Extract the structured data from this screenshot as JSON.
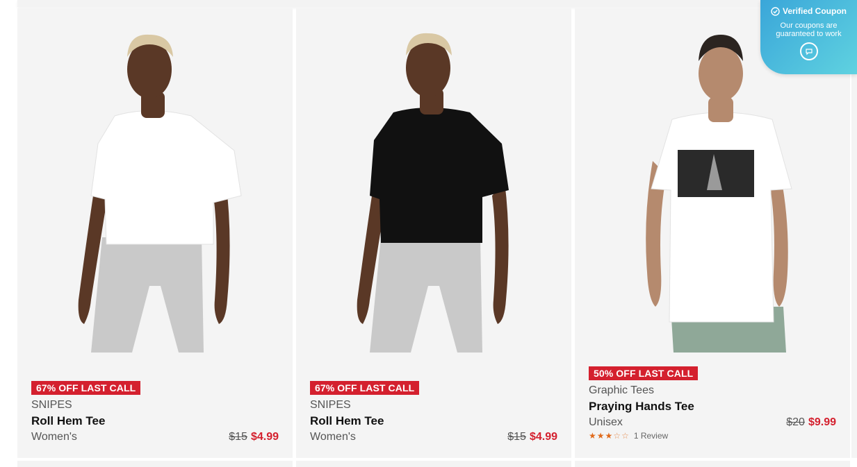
{
  "products": [
    {
      "badge": "67% OFF LAST CALL",
      "brand": "SNIPES",
      "name": "Roll Hem Tee",
      "gender": "Women's",
      "price_old": "$15",
      "price_new": "$4.99",
      "shirt_color": "#ffffff"
    },
    {
      "badge": "67% OFF LAST CALL",
      "brand": "SNIPES",
      "name": "Roll Hem Tee",
      "gender": "Women's",
      "price_old": "$15",
      "price_new": "$4.99",
      "shirt_color": "#111111"
    },
    {
      "badge": "50% OFF LAST CALL",
      "brand": "Graphic Tees",
      "name": "Praying Hands Tee",
      "gender": "Unisex",
      "price_old": "$20",
      "price_new": "$9.99",
      "rating": 3,
      "rating_max": 5,
      "reviews": "1 Review"
    }
  ],
  "coupon": {
    "title": "Verified Coupon",
    "subtitle": "Our coupons are guaranteed to work",
    "icon": "chat-icon"
  },
  "colors": {
    "sale_red": "#d4202e",
    "card_bg": "#f4f4f4",
    "star_orange": "#e06a1b",
    "coupon_gradient": [
      "#3aa6d9",
      "#5fd2e0"
    ]
  }
}
